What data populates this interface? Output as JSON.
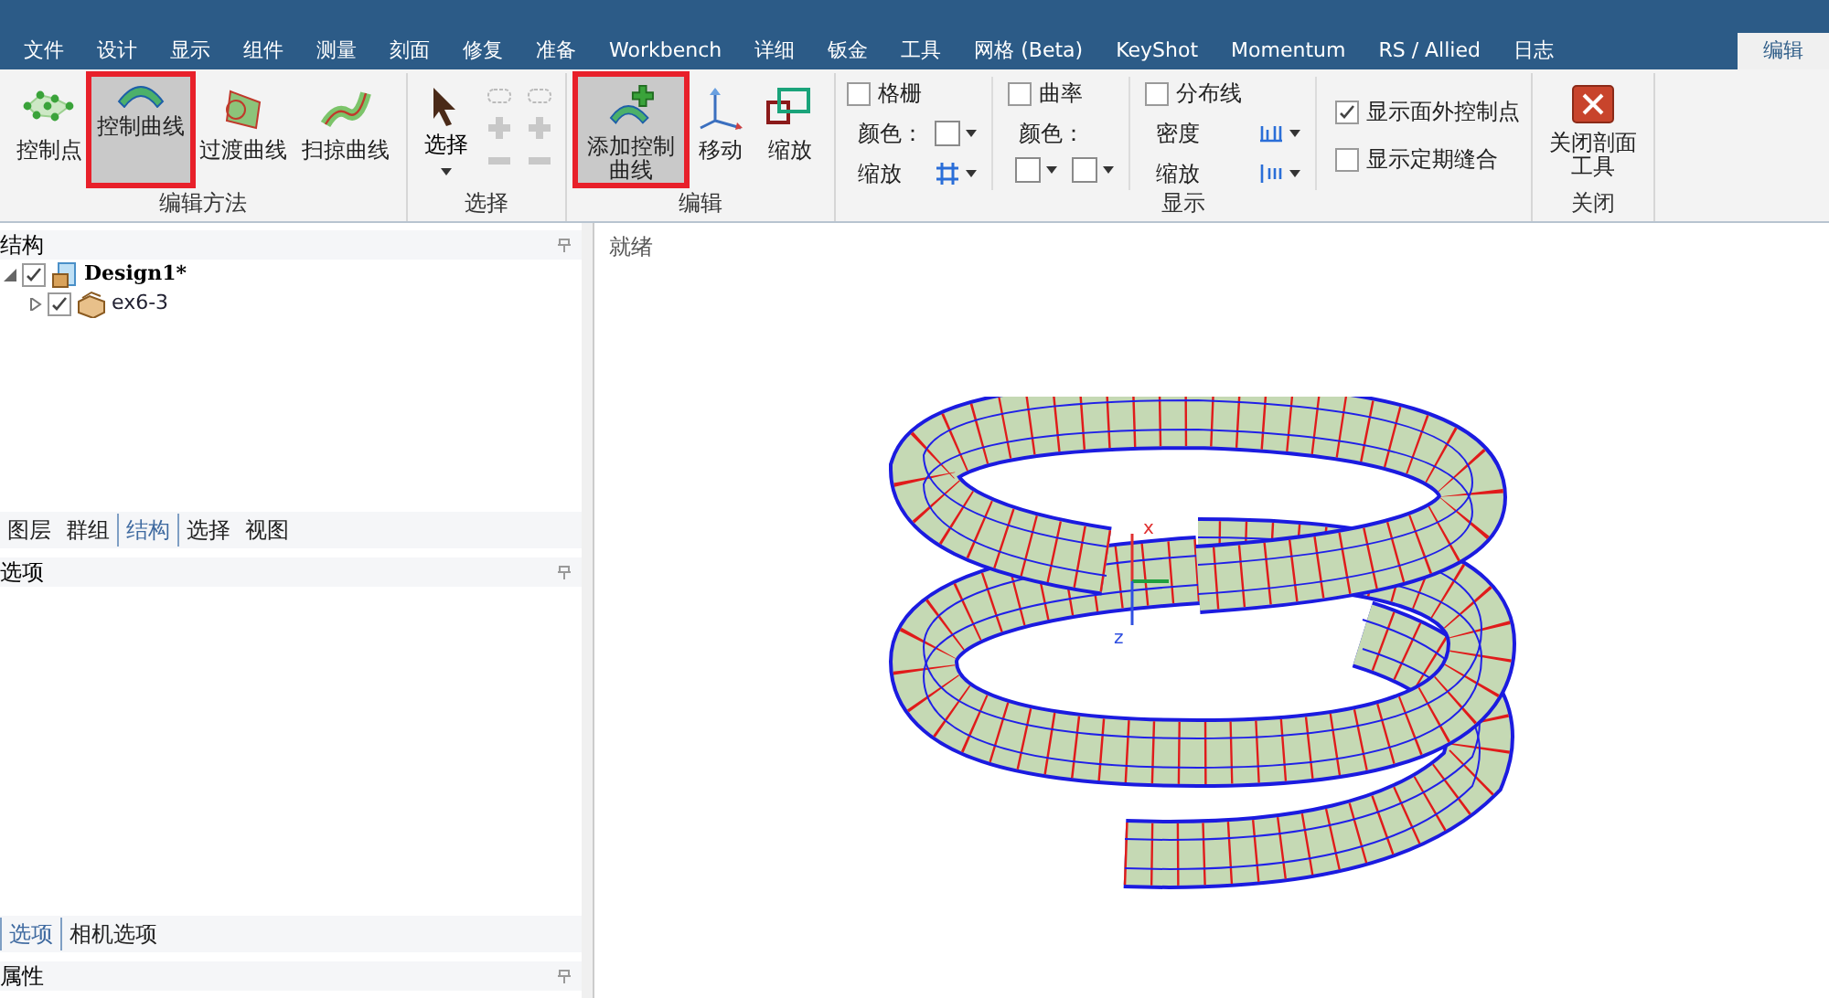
{
  "tabs": [
    {
      "label": "文件",
      "selected": false
    },
    {
      "label": "设计",
      "selected": false
    },
    {
      "label": "显示",
      "selected": false
    },
    {
      "label": "组件",
      "selected": false
    },
    {
      "label": "测量",
      "selected": false
    },
    {
      "label": "刻面",
      "selected": false
    },
    {
      "label": "修复",
      "selected": false
    },
    {
      "label": "准备",
      "selected": false
    },
    {
      "label": "Workbench",
      "selected": false
    },
    {
      "label": "详细",
      "selected": false
    },
    {
      "label": "钣金",
      "selected": false
    },
    {
      "label": "工具",
      "selected": false
    },
    {
      "label": "网格 (Beta)",
      "selected": false
    },
    {
      "label": "KeyShot",
      "selected": false
    },
    {
      "label": "Momentum",
      "selected": false
    },
    {
      "label": "RS / Allied",
      "selected": false
    },
    {
      "label": "日志",
      "selected": false
    },
    {
      "label": "编辑",
      "selected": true
    }
  ],
  "ribbon": {
    "groups": [
      {
        "kind": "tools",
        "label": "编辑方法",
        "tools": [
          {
            "label": "控制点",
            "selected": false,
            "highlighted": false
          },
          {
            "label": "控制曲线",
            "selected": true,
            "highlighted": true
          },
          {
            "label": "过渡曲线",
            "selected": false,
            "highlighted": false
          },
          {
            "label": "扫掠曲线",
            "selected": false,
            "highlighted": false
          }
        ]
      },
      {
        "kind": "select",
        "label": "选择",
        "tools": [
          {
            "label": "选择",
            "selected": false,
            "highlighted": false
          }
        ]
      },
      {
        "kind": "tools",
        "label": "编辑",
        "tools": [
          {
            "label": "添加控制曲线",
            "selected": true,
            "highlighted": true
          },
          {
            "label": "移动",
            "selected": false,
            "highlighted": false
          },
          {
            "label": "缩放",
            "selected": false,
            "highlighted": false
          }
        ]
      },
      {
        "kind": "display",
        "label": "显示",
        "grid": {
          "label": "格栅",
          "checked": false
        },
        "grid_color_label": "颜色：",
        "grid_scale_label": "缩放",
        "curvature": {
          "label": "曲率",
          "checked": false
        },
        "curvature_color_label": "颜色：",
        "distribution": {
          "label": "分布线",
          "checked": false
        },
        "density_label": "密度",
        "distribution_scale_label": "缩放",
        "options": [
          {
            "label": "显示面外控制点",
            "checked": true
          },
          {
            "label": "显示定期缝合",
            "checked": false
          }
        ]
      },
      {
        "kind": "tools",
        "label": "关闭",
        "tools": [
          {
            "label": "关闭剖面工具",
            "selected": false,
            "highlighted": false
          }
        ]
      }
    ]
  },
  "structure_panel": {
    "title": "结构",
    "tree": [
      {
        "label": "Design1*",
        "bold": true,
        "checked": true,
        "expanded": true,
        "children": [
          {
            "label": "ex6-3",
            "bold": false,
            "checked": true,
            "expanded": false
          }
        ]
      }
    ]
  },
  "panel_tabs": [
    {
      "label": "图层",
      "selected": false
    },
    {
      "label": "群组",
      "selected": false
    },
    {
      "label": "结构",
      "selected": true
    },
    {
      "label": "选择",
      "selected": false
    },
    {
      "label": "视图",
      "selected": false
    }
  ],
  "options_panel": {
    "title": "选项"
  },
  "options_tabs": [
    {
      "label": "选项",
      "selected": true
    },
    {
      "label": "相机选项",
      "selected": false
    }
  ],
  "properties_panel": {
    "title": "属性"
  },
  "viewport": {
    "status": "就绪",
    "axis_labels": [
      "x",
      "z"
    ]
  }
}
